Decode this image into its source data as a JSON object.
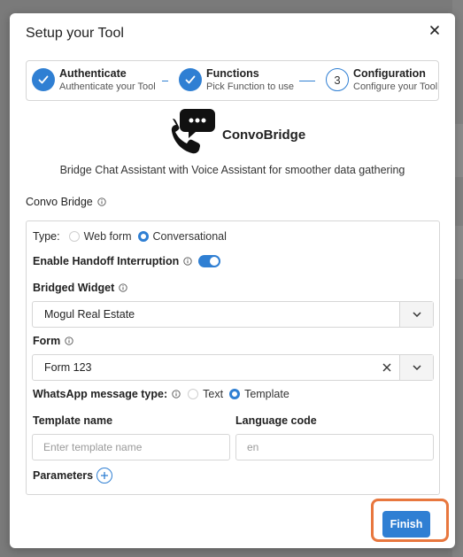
{
  "modal": {
    "title": "Setup your Tool",
    "close_icon": "close-icon"
  },
  "stepper": {
    "steps": [
      {
        "title": "Authenticate",
        "subtitle": "Authenticate your Tool",
        "state": "done"
      },
      {
        "title": "Functions",
        "subtitle": "Pick Function to use",
        "state": "done"
      },
      {
        "title": "Configuration",
        "subtitle": "Configure your Tool",
        "state": "active",
        "number": "3"
      }
    ]
  },
  "brand": {
    "name": "ConvoBridge",
    "description": "Bridge Chat Assistant with Voice Assistant for smoother data gathering",
    "logo_icon": "phone-chat-icon"
  },
  "section": {
    "label": "Convo Bridge"
  },
  "form": {
    "type_label": "Type:",
    "type_options": [
      "Web form",
      "Conversational"
    ],
    "type_selected": "Conversational",
    "handoff_label": "Enable Handoff Interruption",
    "handoff_enabled": true,
    "bridged_widget_label": "Bridged Widget",
    "bridged_widget_value": "Mogul Real Estate",
    "form_label": "Form",
    "form_value": "Form 123",
    "whatsapp_label": "WhatsApp message type:",
    "whatsapp_options": [
      "Text",
      "Template"
    ],
    "whatsapp_selected": "Template",
    "template_name_label": "Template name",
    "template_name_placeholder": "Enter template name",
    "template_name_value": "",
    "language_code_label": "Language code",
    "language_code_placeholder": "en",
    "language_code_value": "",
    "parameters_label": "Parameters"
  },
  "footer": {
    "finish_label": "Finish"
  },
  "colors": {
    "accent": "#2f7fd3",
    "highlight": "#e8773e"
  }
}
